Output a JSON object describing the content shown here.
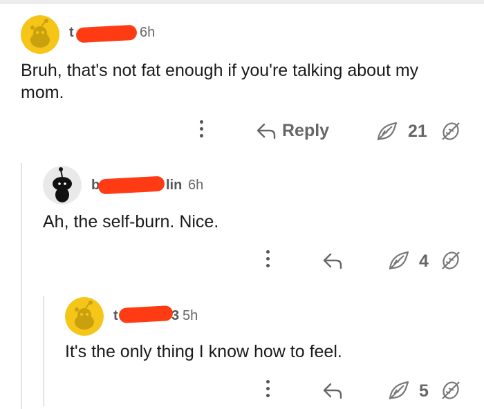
{
  "comments": [
    {
      "username_visible_start": "t",
      "time": "6h",
      "body_line1": "Bruh, that's not fat enough if you're talking about my",
      "body_line2": "mom.",
      "reply_label": "Reply",
      "score": "21"
    },
    {
      "username_visible_start": "b",
      "username_visible_end": "lin",
      "time": "6h",
      "body": "Ah, the self-burn. Nice.",
      "score": "4"
    },
    {
      "username_visible_start": "t",
      "username_visible_end": "3",
      "time": "5h",
      "body": "It's the only thing I know how to feel.",
      "score": "5"
    }
  ],
  "icons": {
    "more": "kebab-icon",
    "reply": "reply-arrow-icon",
    "upvote": "upvote-leaf-icon",
    "downvote": "downvote-leaf-icon"
  },
  "colors": {
    "avatar_yellow": "#F5C518",
    "redaction": "#FF3B14",
    "text": "#1A1A1B",
    "muted": "#666666"
  }
}
